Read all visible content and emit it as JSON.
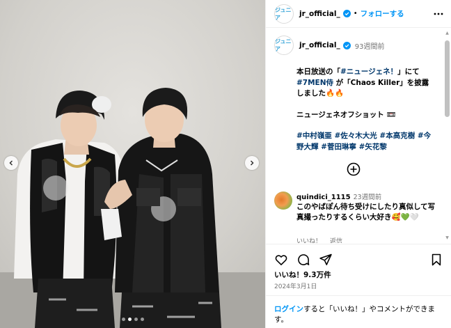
{
  "header": {
    "avatar_text": "ジュニア",
    "username": "jr_official_",
    "separator": "•",
    "follow_label": "フォローする"
  },
  "post": {
    "weeks_ago": "93週間前",
    "caption": {
      "line1_prefix": "本日放送の「",
      "line1_tag": "#ニュージェネ！",
      "line1_suffix": "」にて",
      "line2_tag": "#7MEN侍",
      "line2_mid": " が「Chaos Killer」を披露しました",
      "line2_emoji": "🔥🔥",
      "line3": "ニュージェネオフショット",
      "line3_emoji": "📼",
      "tags": "#中村嶺亜 #佐々木大光 #本高克樹 #今野大輝 #菅田琳寧 #矢花黎"
    },
    "comment": {
      "user": "quindici_1115",
      "time": "23週間前",
      "text": "このやばぽん待ち受けにしたり真似して写真撮ったりするくらい大好き",
      "emoji": "🥰💚🤍",
      "like_label": "いいね！",
      "reply_label": "返信"
    },
    "likes": "いいね！9.3万件",
    "date": "2024年3月1日"
  },
  "login": {
    "link": "ログイン",
    "text": "すると「いいね！」やコメントができます。"
  },
  "photo": {
    "slide_count": 4,
    "active_slide": 1
  },
  "colors": {
    "accent": "#0095f6",
    "tag": "#00376b",
    "muted": "#737373"
  }
}
